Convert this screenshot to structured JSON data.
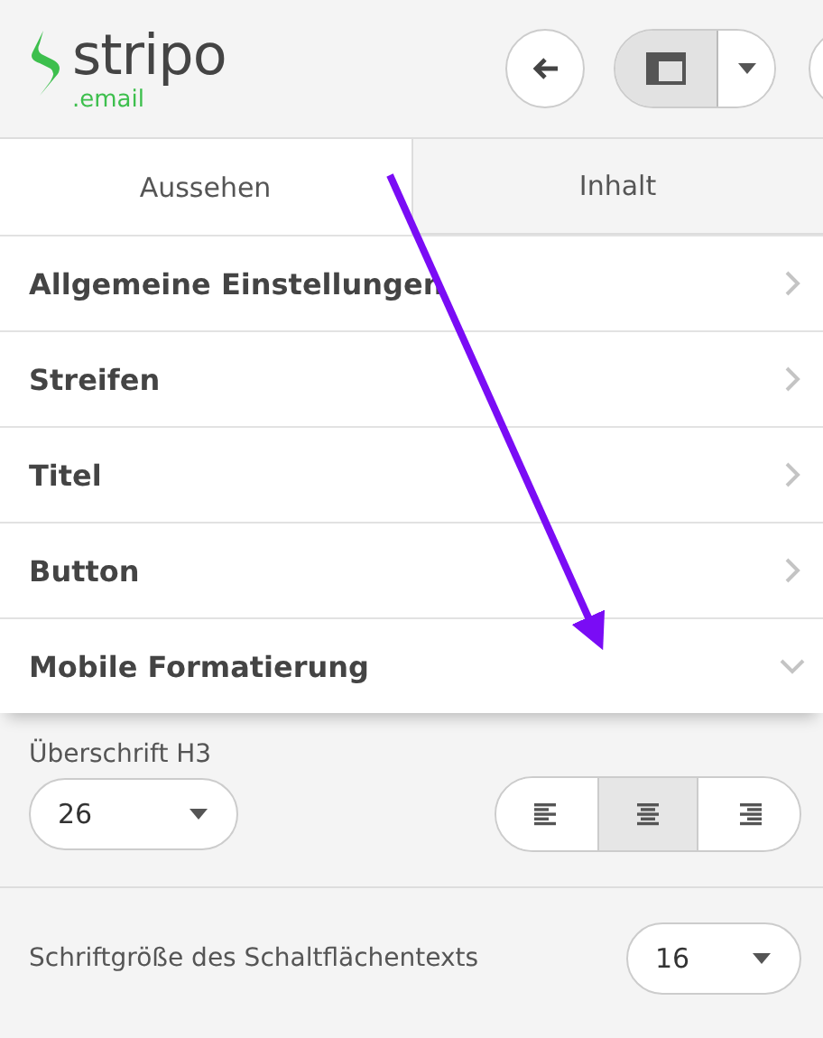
{
  "logo": {
    "name": "stripo",
    "suffix": ".email"
  },
  "toolbar": {
    "layout_toggle": {
      "selected": true
    }
  },
  "tabs": [
    {
      "label": "Aussehen",
      "selected": true
    },
    {
      "label": "Inhalt",
      "selected": false
    }
  ],
  "sections": [
    {
      "label": "Allgemeine Einstellungen",
      "expanded": false
    },
    {
      "label": "Streifen",
      "expanded": false
    },
    {
      "label": "Titel",
      "expanded": false
    },
    {
      "label": "Button",
      "expanded": false
    },
    {
      "label": "Mobile Formatierung",
      "expanded": true
    }
  ],
  "mobile": {
    "heading_label": "Überschrift H3",
    "heading_size": "26",
    "alignment": [
      {
        "kind": "left",
        "selected": false
      },
      {
        "kind": "center",
        "selected": true
      },
      {
        "kind": "right",
        "selected": false
      }
    ],
    "button_label": "Schriftgröße des Schaltflächentexts",
    "button_size": "16"
  }
}
